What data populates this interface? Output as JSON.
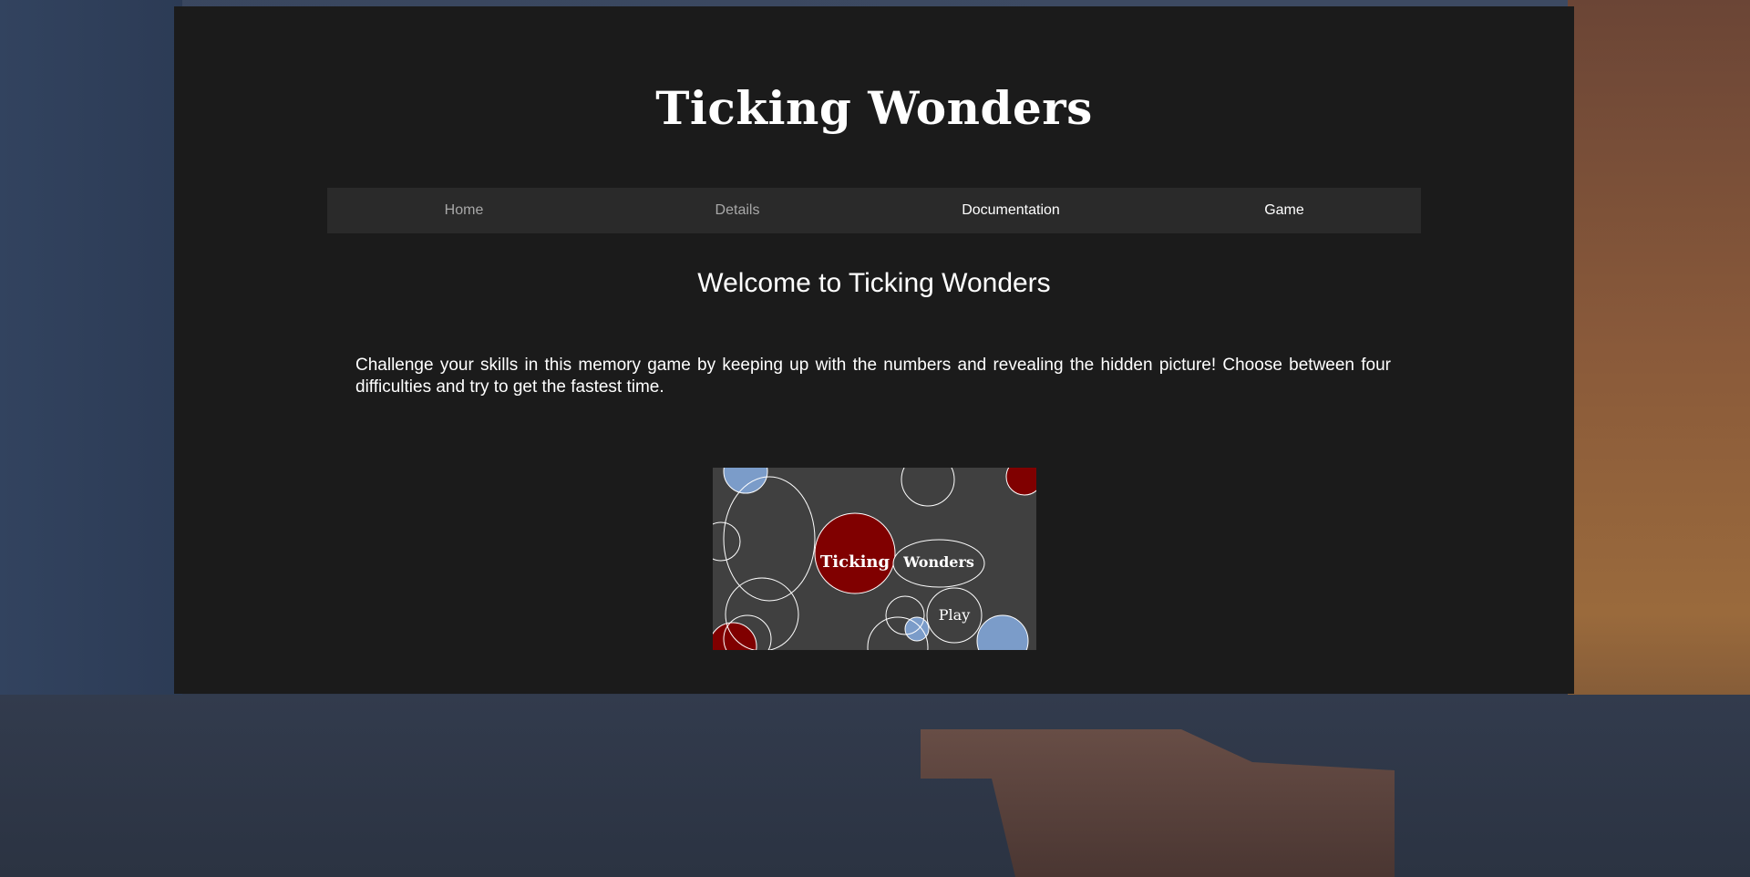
{
  "site": {
    "title": "Ticking Wonders"
  },
  "nav": {
    "items": [
      {
        "label": "Home"
      },
      {
        "label": "Details"
      },
      {
        "label": "Documentation"
      },
      {
        "label": "Game"
      }
    ]
  },
  "main": {
    "heading": "Welcome to Ticking Wonders",
    "intro": "Challenge your skills in this memory game by keeping up with the numbers and revealing the hidden picture! Choose between four difficulties and try to get the fastest time."
  },
  "preview": {
    "word_left": "Ticking",
    "word_right": "Wonders",
    "play": "Play",
    "colors": {
      "background": "#404040",
      "red": "#800000",
      "blue": "#7b9cc9",
      "outline": "#ffffff"
    }
  },
  "colors": {
    "panel": "#1b1b1b",
    "nav_bar": "#2a2a2a"
  }
}
